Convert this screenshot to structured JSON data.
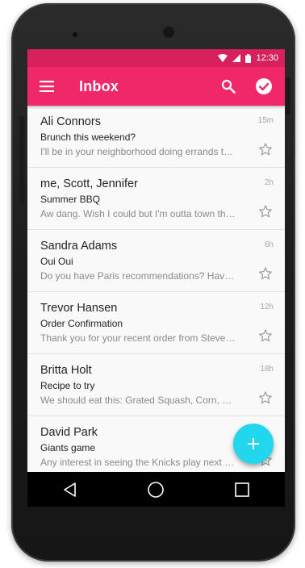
{
  "status_bar": {
    "time": "12:30"
  },
  "app_bar": {
    "title": "Inbox",
    "icons": [
      "menu-icon",
      "search-icon",
      "check-circle-icon"
    ]
  },
  "emails": [
    {
      "sender": "Ali Connors",
      "subject": "Brunch this weekend?",
      "preview": "I'll be in your neighborhood doing errands this weekend. Do you want to grab brunch?",
      "time": "15m"
    },
    {
      "sender": "me, Scott, Jennifer",
      "subject": "Summer BBQ",
      "preview": "Aw dang. Wish I could but I'm outta town this weekend.",
      "time": "2h"
    },
    {
      "sender": "Sandra Adams",
      "subject": "Oui Oui",
      "preview": "Do you have Paris recommendations? Have you ever been?",
      "time": "6h"
    },
    {
      "sender": "Trevor Hansen",
      "subject": "Order Confirmation",
      "preview": "Thank you for your recent order from Steve's shop.",
      "time": "12h"
    },
    {
      "sender": "Britta Holt",
      "subject": "Recipe to try",
      "preview": "We should eat this: Grated Squash, Corn, and tomatoes.",
      "time": "18h"
    },
    {
      "sender": "David Park",
      "subject": "Giants game",
      "preview": "Any interest in seeing the Knicks play next week?",
      "time": ""
    }
  ],
  "fab": {
    "icon": "plus-icon",
    "label": "+"
  },
  "colors": {
    "status_bar": "#d6215d",
    "app_bar": "#f0286a",
    "fab": "#22d6ee"
  }
}
